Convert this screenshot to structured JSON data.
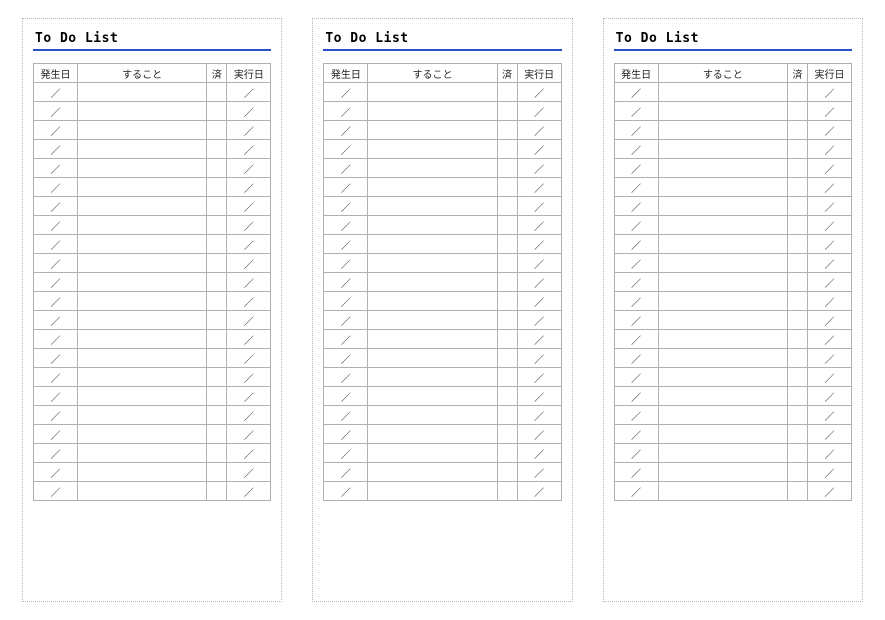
{
  "list_title": "To Do List",
  "columns": {
    "start_date": "発生日",
    "task": "すること",
    "done": "済",
    "exec_date": "実行日"
  },
  "date_placeholder": "／",
  "row_count": 22,
  "page_count": 3
}
